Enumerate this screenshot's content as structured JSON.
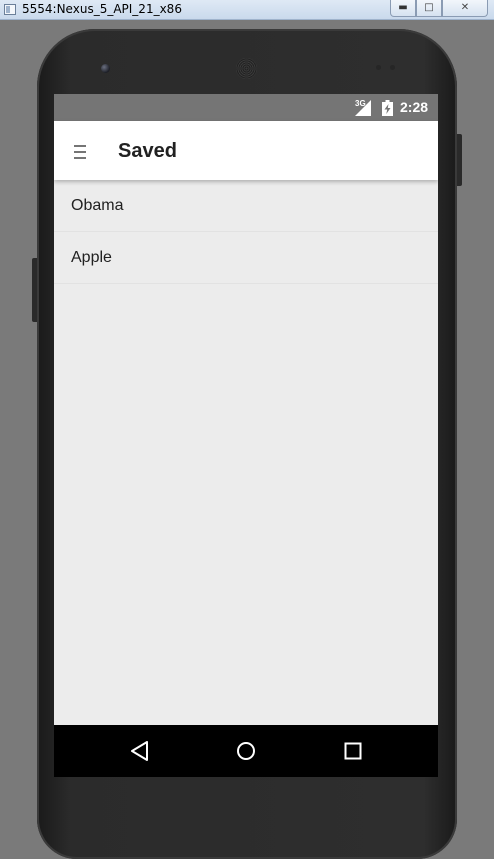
{
  "window": {
    "title": "5554:Nexus_5_API_21_x86",
    "minimize_glyph": "▬",
    "maximize_glyph": "□",
    "close_glyph": "✕"
  },
  "status_bar": {
    "network_type": "3G",
    "time": "2:28",
    "icons": [
      "signal-icon",
      "battery-icon"
    ]
  },
  "toolbar": {
    "menu_icon": "menu-icon",
    "title": "Saved"
  },
  "list": {
    "items": [
      {
        "label": "Obama"
      },
      {
        "label": "Apple"
      }
    ]
  },
  "nav_bar": {
    "icons": [
      "back-icon",
      "home-icon",
      "recents-icon"
    ]
  },
  "colors": {
    "status_bar": "#757575",
    "toolbar": "#ffffff",
    "content_background": "#ececec",
    "nav_bar": "#000000",
    "text_primary": "#212121"
  }
}
